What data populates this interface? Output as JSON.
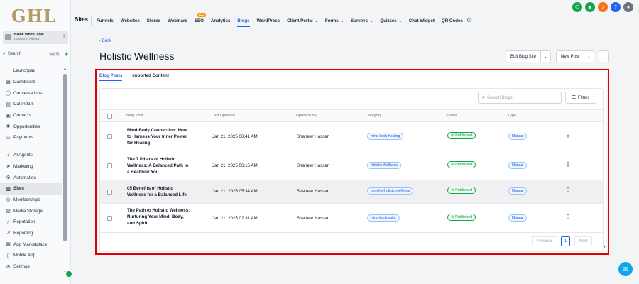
{
  "sidebar": {
    "logo": "GHL",
    "account": {
      "name": "Blank WhiteLabel",
      "location": "Canmore, Alberta"
    },
    "search": {
      "label": "Search",
      "shortcut": "ctrl K"
    },
    "items": [
      {
        "label": "Launchpad",
        "icon": "launchpad-icon"
      },
      {
        "label": "Dashboard",
        "icon": "dashboard-icon"
      },
      {
        "label": "Conversations",
        "icon": "chat-icon"
      },
      {
        "label": "Calendars",
        "icon": "calendar-icon"
      },
      {
        "label": "Contacts",
        "icon": "contacts-icon"
      },
      {
        "label": "Opportunities",
        "icon": "opportunities-icon"
      },
      {
        "label": "Payments",
        "icon": "payments-icon"
      },
      {
        "label": "AI Agents",
        "icon": "ai-icon"
      },
      {
        "label": "Marketing",
        "icon": "marketing-icon"
      },
      {
        "label": "Automation",
        "icon": "automation-icon"
      },
      {
        "label": "Sites",
        "icon": "sites-icon"
      },
      {
        "label": "Memberships",
        "icon": "memberships-icon"
      },
      {
        "label": "Media Storage",
        "icon": "media-icon"
      },
      {
        "label": "Reputation",
        "icon": "reputation-icon"
      },
      {
        "label": "Reporting",
        "icon": "reporting-icon"
      },
      {
        "label": "App Marketplace",
        "icon": "marketplace-icon"
      },
      {
        "label": "Mobile App",
        "icon": "mobile-icon"
      },
      {
        "label": "Settings",
        "icon": "settings-icon"
      }
    ]
  },
  "topnav": {
    "title": "Sites",
    "tabs": [
      {
        "label": "Funnels"
      },
      {
        "label": "Websites"
      },
      {
        "label": "Stores"
      },
      {
        "label": "Webinars"
      },
      {
        "label": "SEO",
        "badge": "New"
      },
      {
        "label": "Analytics"
      },
      {
        "label": "Blogs",
        "active": true
      },
      {
        "label": "WordPress"
      },
      {
        "label": "Client Portal",
        "dropdown": true
      },
      {
        "label": "Forms",
        "dropdown": true
      },
      {
        "label": "Surveys",
        "dropdown": true
      },
      {
        "label": "Quizzes",
        "dropdown": true
      },
      {
        "label": "Chat Widget"
      },
      {
        "label": "QR Codes"
      }
    ]
  },
  "page": {
    "back_label": "Back",
    "title": "Holistic Wellness",
    "edit_blog_site": "Edit Blog Site",
    "new_post": "New Post",
    "subtabs": [
      "Blog Posts",
      "Imported Content"
    ],
    "search_placeholder": "Search Blogs",
    "filters_label": "Filters"
  },
  "table": {
    "columns": [
      "Blog Post",
      "Last Updated",
      "Updated By",
      "Category",
      "Status",
      "Type"
    ],
    "rows": [
      {
        "title": "Mind-Body Connection: How to Harness Your Inner Power for Healing",
        "updated": "Jan 21, 2025 06:41 AM",
        "by": "Shaheer Hassan",
        "category": "mind-body-healing",
        "status": "Published",
        "type": "Manual"
      },
      {
        "title": "The 7 Pillars of Holistic Wellness: A Balanced Path to a Healthier You",
        "updated": "Jan 21, 2025 06:15 AM",
        "by": "Shaheer Hassan",
        "category": "Holistic Wellness",
        "status": "Published",
        "type": "Manual"
      },
      {
        "title": "05 Benefits of Holistic Wellness for a Balanced Life",
        "updated": "Jan 21, 2025 05:34 AM",
        "by": "Shaheer Hassan",
        "category": "benefits-holistic-wellness",
        "status": "Published",
        "type": "Manual"
      },
      {
        "title": "The Path to Holistic Wellness: Nurturing Your Mind, Body, and Spirit",
        "updated": "Jan 21, 2025 02:31 AM",
        "by": "Shaheer Hassan",
        "category": "mind-body-spirit",
        "status": "Published",
        "type": "Manual"
      }
    ]
  },
  "pagination": {
    "previous": "Previous",
    "current": "1",
    "next": "Next"
  },
  "colors": {
    "accent": "#2563eb",
    "published": "#16a34a",
    "highlight_border": "#e00000",
    "logo": "#b59a6a"
  }
}
